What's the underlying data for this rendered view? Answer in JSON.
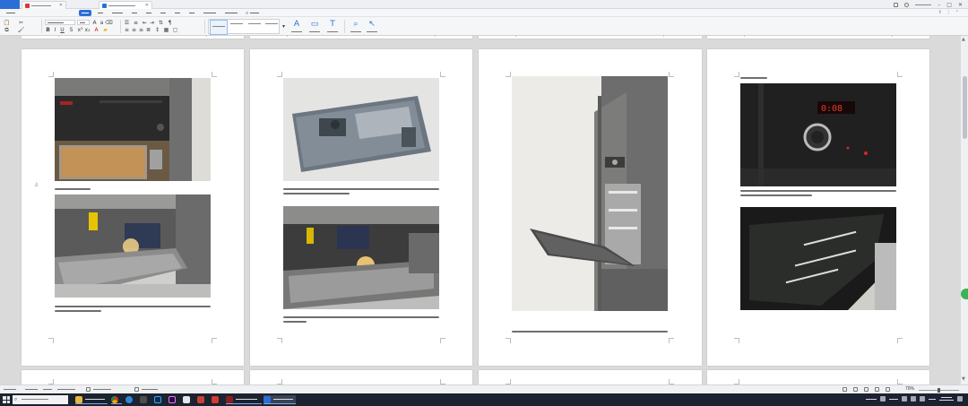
{
  "titlebar": {
    "home_tab": "",
    "tabs": [
      {
        "label": "",
        "icon": "wps-app-icon",
        "active": false
      },
      {
        "label": "",
        "icon": "word-doc-icon",
        "active": true
      }
    ]
  },
  "menubar": {
    "items": [
      {
        "label": "",
        "active": false
      },
      {
        "label": "",
        "active": true
      },
      {
        "label": "",
        "active": false
      },
      {
        "label": "",
        "active": false
      },
      {
        "label": "",
        "active": false
      },
      {
        "label": "",
        "active": false
      },
      {
        "label": "",
        "active": false
      },
      {
        "label": "",
        "active": false
      },
      {
        "label": "",
        "active": false
      },
      {
        "label": "",
        "active": false
      },
      {
        "label": "",
        "active": false
      }
    ],
    "search_label": ""
  },
  "ribbon": {
    "font_name": "",
    "font_size": "",
    "styles": [
      {
        "sample": "",
        "label": "",
        "active": true
      },
      {
        "sample": "",
        "label": "",
        "active": false
      },
      {
        "sample": "",
        "label": "",
        "active": false
      },
      {
        "sample": "",
        "label": "",
        "active": false
      }
    ],
    "big_buttons": [
      {
        "label": "",
        "icon": "new-style-icon"
      },
      {
        "label": "",
        "icon": "text-box-icon"
      },
      {
        "label": "",
        "icon": "text-tools-icon"
      },
      {
        "label": "",
        "icon": "find-replace-icon"
      },
      {
        "label": "",
        "icon": "select-icon"
      }
    ]
  },
  "document": {
    "pages": [
      {
        "captions": [
          {
            "text": ""
          },
          {
            "text": ""
          }
        ]
      },
      {
        "captions": [
          {
            "text": ""
          },
          {
            "text": ""
          }
        ]
      },
      {
        "captions": [
          {
            "text": ""
          }
        ]
      },
      {
        "captions": [
          {
            "text": ""
          },
          {
            "text": ""
          }
        ]
      }
    ]
  },
  "statusbar": {
    "page_info": "",
    "section_info": "",
    "page_count": "",
    "word_count": "",
    "zoom": "70%"
  },
  "taskbar": {
    "search_placeholder": "",
    "apps": [
      {
        "name": "explorer-icon",
        "label": ""
      },
      {
        "name": "chrome-icon",
        "label": ""
      },
      {
        "name": "edge-icon",
        "label": ""
      },
      {
        "name": "terminal-icon",
        "label": ""
      },
      {
        "name": "photoshop-icon",
        "label": ""
      },
      {
        "name": "premiere-icon",
        "label": ""
      },
      {
        "name": "store-icon",
        "label": ""
      },
      {
        "name": "wechat-icon",
        "label": ""
      },
      {
        "name": "wps-icon",
        "label": ""
      },
      {
        "name": "monitor-app-icon",
        "label": ""
      },
      {
        "name": "wps-doc-window-icon",
        "label": ""
      }
    ],
    "clock_time": "",
    "clock_date": "",
    "ime": ""
  },
  "colors": {
    "accent": "#2b6fd6",
    "taskbar": "#1b2230",
    "canvas": "#dadada"
  }
}
